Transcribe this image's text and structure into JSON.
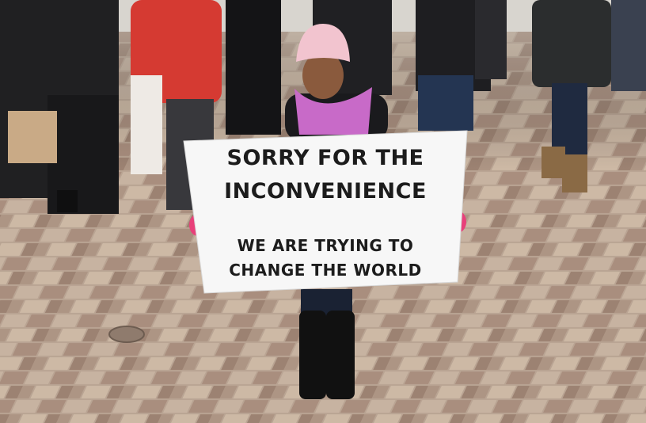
{
  "photo": {
    "description_icon": "photo-icon"
  },
  "sign": {
    "line1": "SORRY FOR THE",
    "line2": "INCONVENIENCE",
    "line3": "WE ARE TRYING TO",
    "line4": "CHANGE THE WORLD"
  },
  "colors": {
    "hat": "#f2c4cf",
    "scarf": "#c86ac8",
    "gloves": "#e8407a",
    "sign": "#f7f7f7"
  }
}
